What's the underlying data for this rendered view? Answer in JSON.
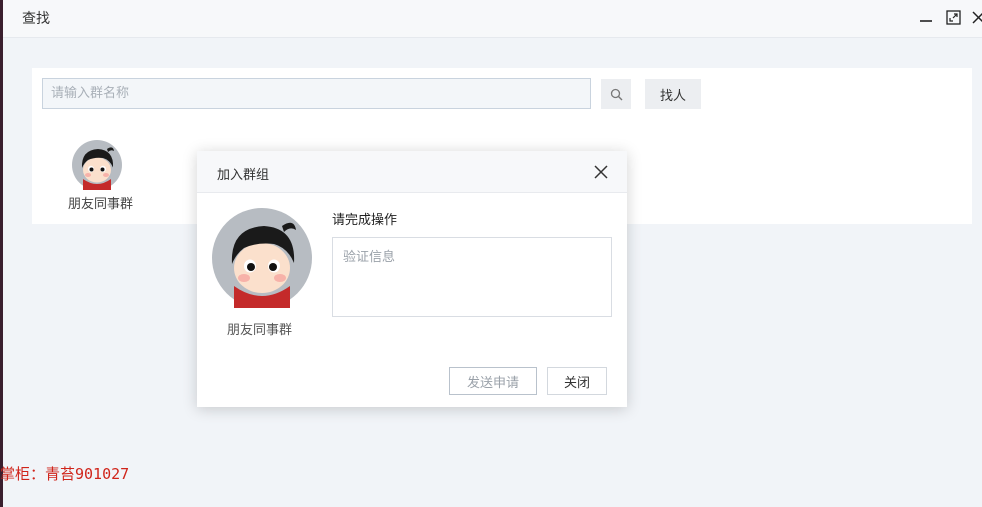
{
  "window": {
    "title": "查找"
  },
  "search": {
    "placeholder": "请输入群名称",
    "value": "",
    "find_label": "找人"
  },
  "results": [
    {
      "name": "朋友同事群"
    }
  ],
  "dialog": {
    "title": "加入群组",
    "group_name": "朋友同事群",
    "prompt": "请完成操作",
    "verify_placeholder": "验证信息",
    "send_label": "发送申请",
    "close_label": "关闭"
  },
  "watermark": {
    "text": "掌柜：青苔901027"
  },
  "colors": {
    "accent_red": "#d0241a",
    "background": "#f1f4f8"
  },
  "icons": [
    "minimize-icon",
    "maximize-icon",
    "close-icon",
    "search-icon",
    "avatar-icon"
  ]
}
